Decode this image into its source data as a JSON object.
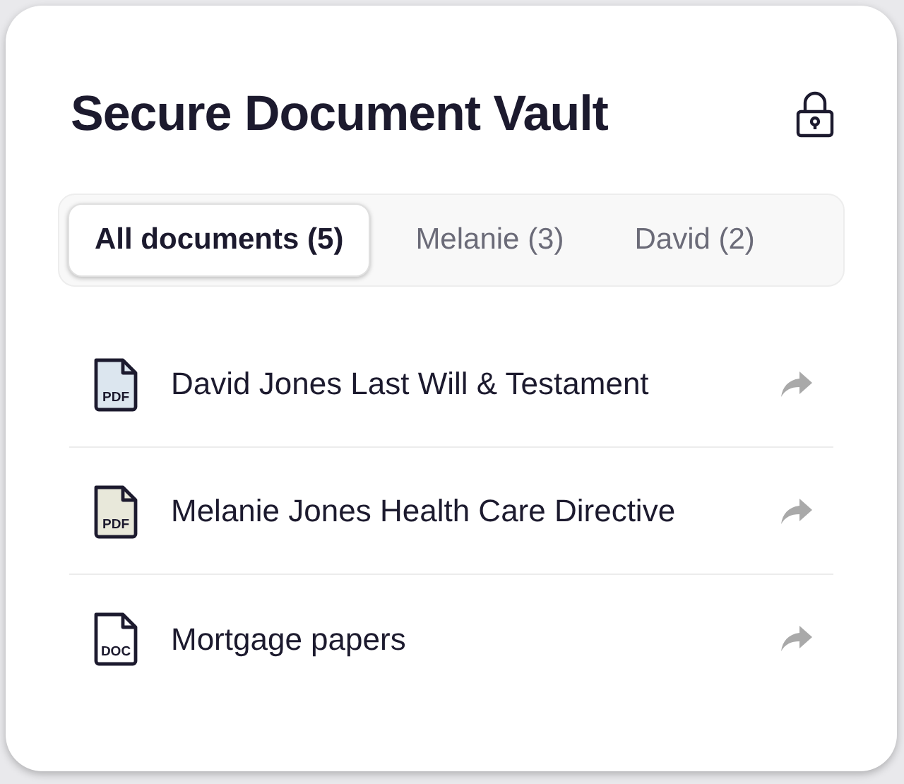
{
  "title": "Secure Document Vault",
  "tabs": [
    {
      "label": "All documents (5)",
      "selected": true
    },
    {
      "label": "Melanie (3)",
      "selected": false
    },
    {
      "label": "David (2)",
      "selected": false
    }
  ],
  "documents": [
    {
      "name": "David Jones Last Will & Testament",
      "file_type": "PDF",
      "color": "#dce6ef"
    },
    {
      "name": "Melanie Jones Health Care Directive",
      "file_type": "PDF",
      "color": "#e8e8da"
    },
    {
      "name": "Mortgage papers",
      "file_type": "DOC",
      "color": "#ffffff"
    }
  ]
}
